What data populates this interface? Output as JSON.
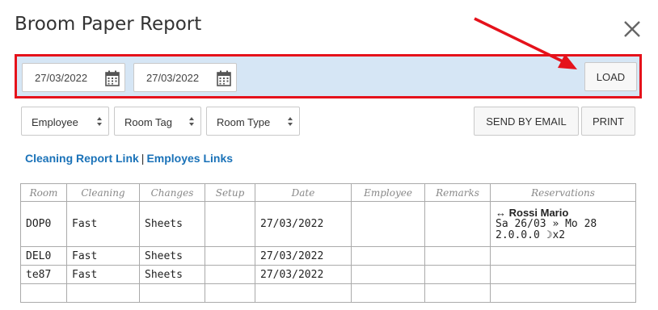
{
  "window": {
    "title": "Broom Paper Report",
    "close_icon": "close-icon"
  },
  "filters": {
    "date_from": "27/03/2022",
    "date_to": "27/03/2022",
    "calendar_icon": "calendar-icon",
    "load_label": "LOAD",
    "highlight_color": "#e5121b"
  },
  "selects": {
    "employee": "Employee",
    "room_tag": "Room Tag",
    "room_type": "Room Type"
  },
  "actions": {
    "send_email": "SEND BY EMAIL",
    "print": "PRINT"
  },
  "links": {
    "cleaning_report": "Cleaning Report Link",
    "separator": "|",
    "employees": "Employes Links"
  },
  "table": {
    "columns": [
      "Room",
      "Cleaning",
      "Changes",
      "Setup",
      "Date",
      "Employee",
      "Remarks",
      "Reservations"
    ],
    "rows": [
      {
        "room": "DOP0",
        "cleaning": "Fast",
        "changes": "Sheets",
        "setup": "",
        "date": "27/03/2022",
        "employee": "",
        "remarks": "",
        "reservation": {
          "guest": "↔ Rossi Mario",
          "dates": "Sa 26/03 » Mo 28",
          "occupancy": "2.0.0.0 ☽x2"
        }
      },
      {
        "room": "DEL0",
        "cleaning": "Fast",
        "changes": "Sheets",
        "setup": "",
        "date": "27/03/2022",
        "employee": "",
        "remarks": ""
      },
      {
        "room": "te87",
        "cleaning": "Fast",
        "changes": "Sheets",
        "setup": "",
        "date": "27/03/2022",
        "employee": "",
        "remarks": ""
      }
    ]
  }
}
